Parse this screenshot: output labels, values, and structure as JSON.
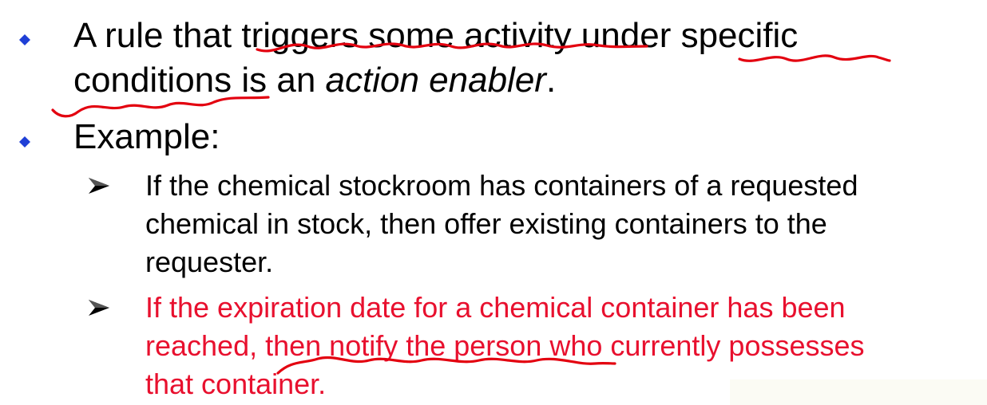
{
  "bullets": [
    {
      "line1": "A rule that triggers some activity under specific",
      "line2_plain": "conditions is an ",
      "line2_italic": "action enabler",
      "line2_end": "."
    },
    {
      "line1": "Example:"
    }
  ],
  "examples": [
    {
      "lines": [
        "If the chemical stockroom has containers of a requested",
        "chemical in stock, then offer existing containers to the",
        "requester."
      ]
    },
    {
      "lines": [
        "If the expiration date for a chemical container has been",
        "reached, then notify the person who currently possesses",
        "that container."
      ]
    }
  ],
  "colors": {
    "bullet": "#1f3fd6",
    "highlight_text": "#e8102e",
    "ink_annotation": "#e3000f"
  },
  "icons": {
    "level1_bullet": "diamond-icon",
    "level2_bullet": "arrowhead-icon"
  }
}
